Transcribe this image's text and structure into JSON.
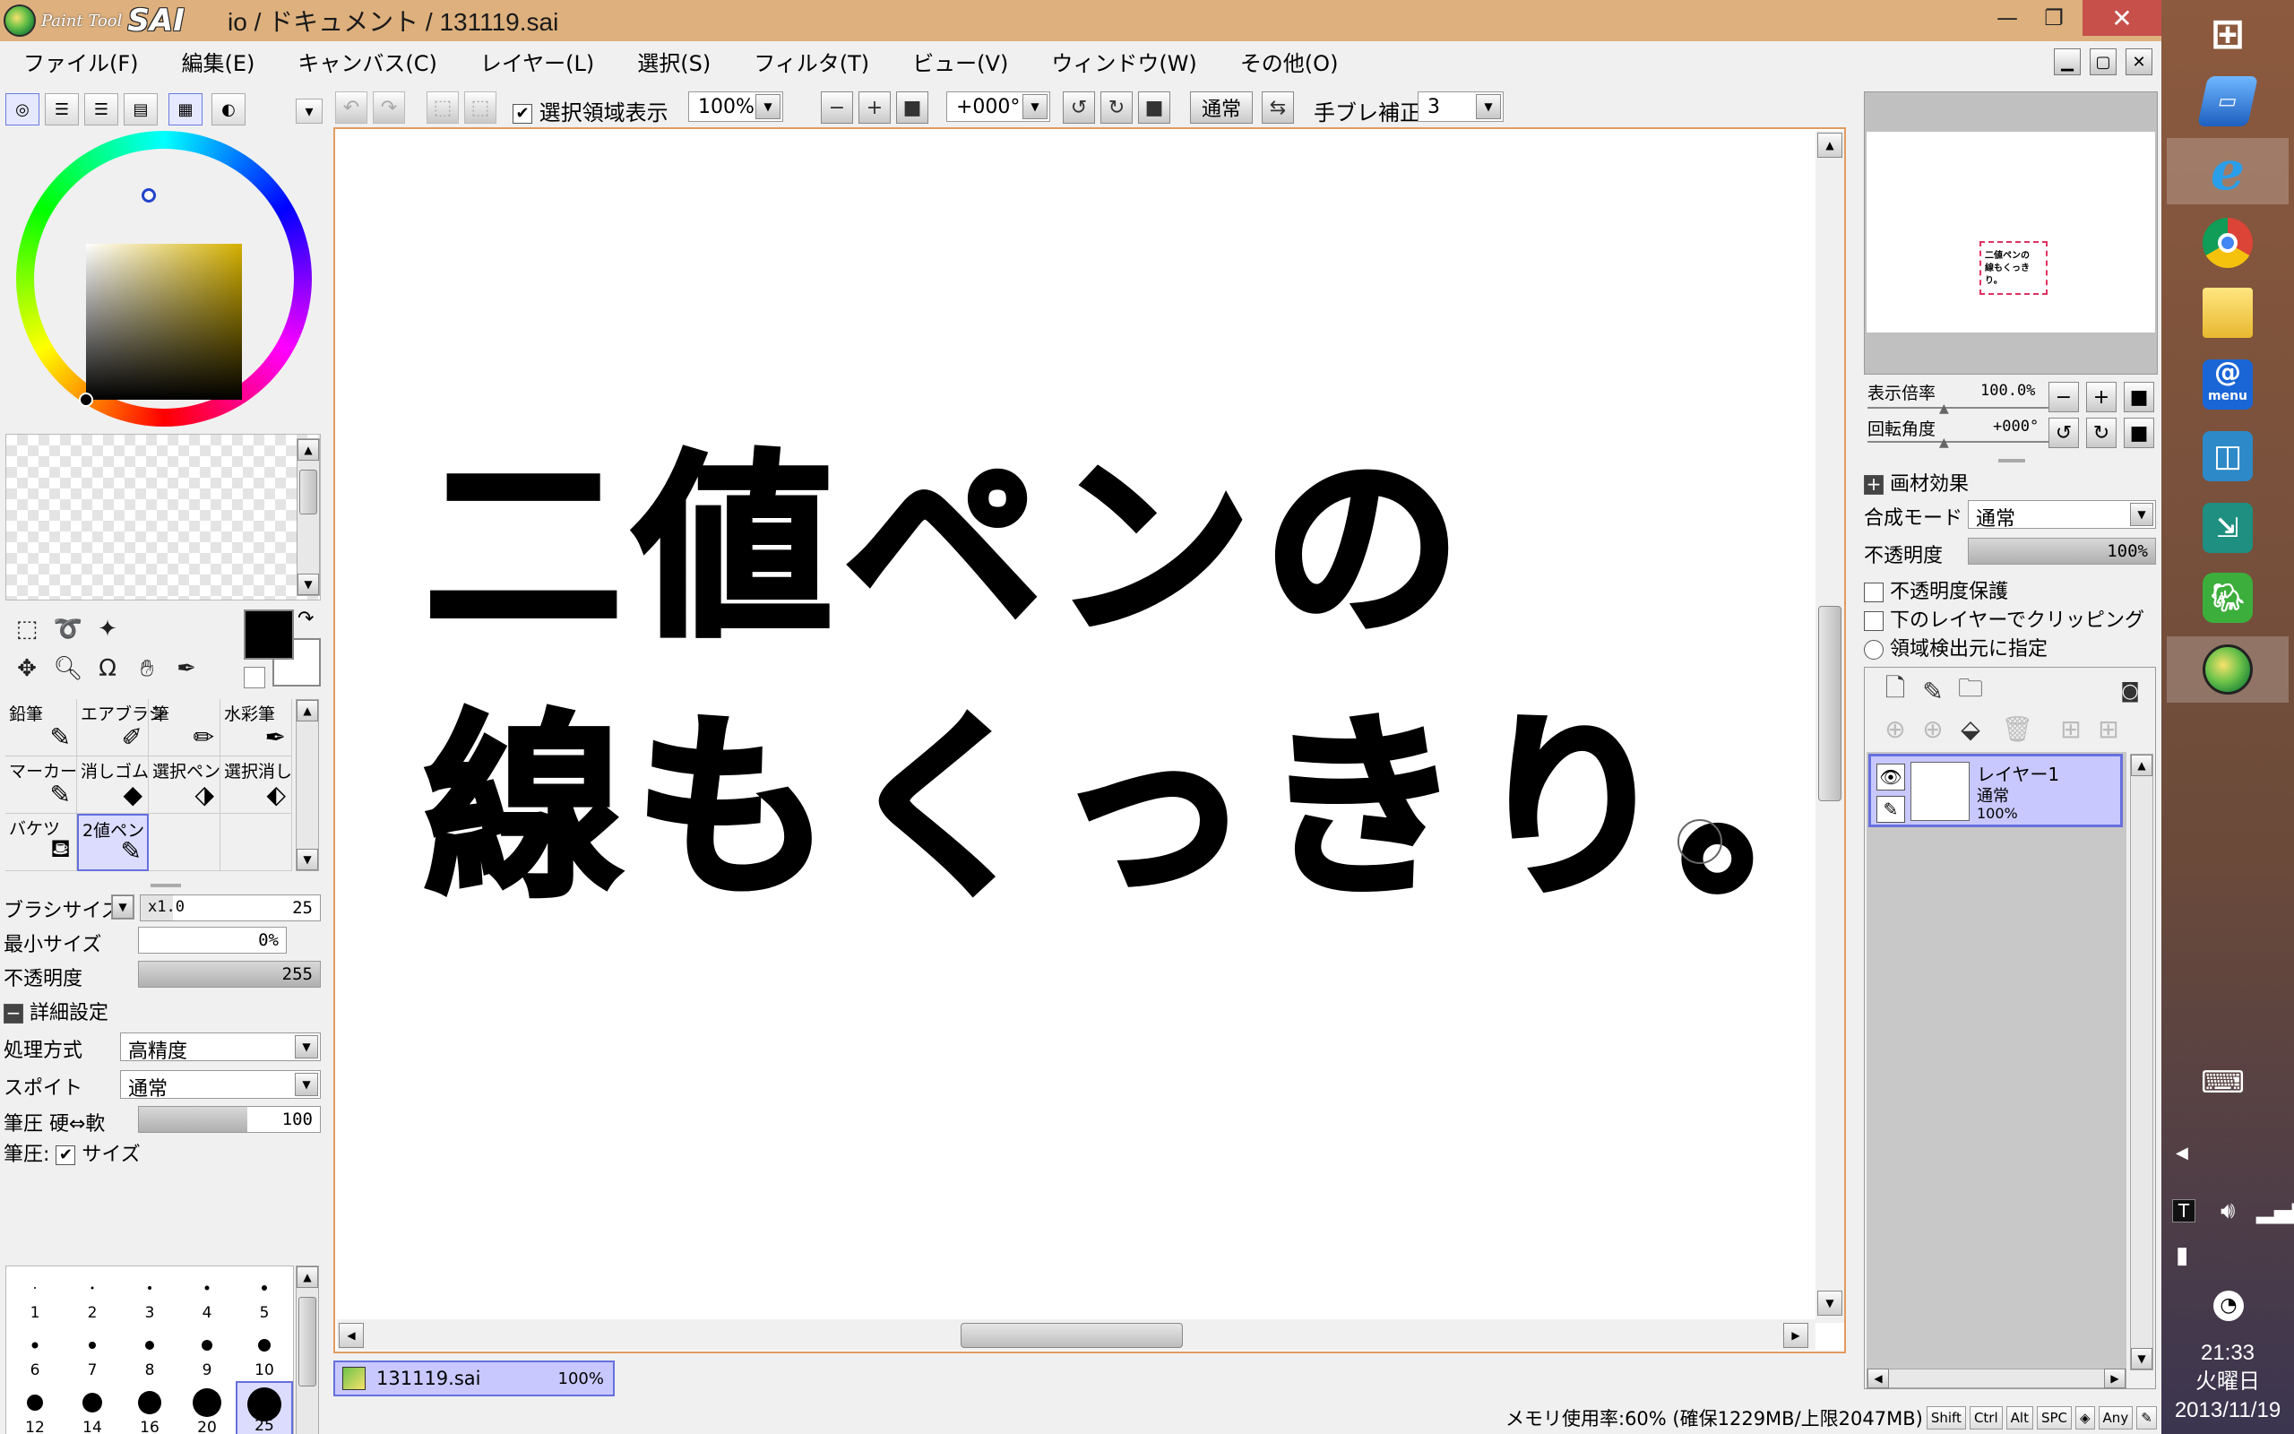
{
  "window": {
    "logo_small": "Paint Tool",
    "logo_big": "SAI",
    "title": "io / ドキュメント / 131119.sai",
    "min_glyph": "—",
    "max_glyph": "❐",
    "close_glyph": "✕"
  },
  "menu": {
    "items": [
      "ファイル(F)",
      "編集(E)",
      "キャンバス(C)",
      "レイヤー(L)",
      "選択(S)",
      "フィルタ(T)",
      "ビュー(V)",
      "ウィンドウ(W)",
      "その他(O)"
    ]
  },
  "toolbar": {
    "show_selection_label": "選択領域表示",
    "show_selection_checked": true,
    "zoom": "100%",
    "rotation": "+000°",
    "blend": "通常",
    "stabilizer_label": "手ブレ補正",
    "stabilizer_value": "3"
  },
  "tools": {
    "brushes": [
      {
        "label": "鉛筆",
        "icon": "pencil-icon"
      },
      {
        "label": "エアブラシ",
        "icon": "airbrush-icon"
      },
      {
        "label": "筆",
        "icon": "brush-icon"
      },
      {
        "label": "水彩筆",
        "icon": "watercolor-icon"
      },
      {
        "label": "マーカー",
        "icon": "marker-icon"
      },
      {
        "label": "消しゴム",
        "icon": "eraser-icon"
      },
      {
        "label": "選択ペン",
        "icon": "select-pen-icon"
      },
      {
        "label": "選択消し",
        "icon": "select-eraser-icon"
      },
      {
        "label": "バケツ",
        "icon": "bucket-icon"
      },
      {
        "label": "2値ペン",
        "icon": "binary-pen-icon",
        "active": true
      }
    ]
  },
  "brush_params": {
    "size_label": "ブラシサイズ",
    "size_multiplier": "x1.0",
    "size_value": "25",
    "min_size_label": "最小サイズ",
    "min_size_value": "0%",
    "opacity_label": "不透明度",
    "opacity_value": "255",
    "details_label": "詳細設定",
    "quality_label": "処理方式",
    "quality_value": "高精度",
    "spuit_label": "スポイト",
    "spuit_value": "通常",
    "pressure_hardness_label": "筆圧 硬⇔軟",
    "pressure_hardness_value": "100",
    "pressure_hardness_fraction": 0.6,
    "pressure_label": "筆圧:",
    "pressure_size_label": "サイズ",
    "pressure_size_checked": true
  },
  "brush_sizes": {
    "labels": [
      "1",
      "2",
      "3",
      "4",
      "5",
      "6",
      "7",
      "8",
      "9",
      "10",
      "12",
      "14",
      "16",
      "20",
      "25"
    ],
    "selected": "25"
  },
  "canvas": {
    "line1": "二値ペンの",
    "line2": "線もくっきり。"
  },
  "document_tab": {
    "name": "131119.sai",
    "zoom": "100%"
  },
  "navigator": {
    "thumb_line1": "二値ペンの",
    "thumb_line2": "線もくっきり。",
    "zoom_label": "表示倍率",
    "zoom_value": "100.0%",
    "angle_label": "回転角度",
    "angle_value": "+000°"
  },
  "layer_props": {
    "texture_label": "画材効果",
    "blend_label": "合成モード",
    "blend_value": "通常",
    "opacity_label": "不透明度",
    "opacity_value": "100%",
    "protect_label": "不透明度保護",
    "clip_label": "下のレイヤーでクリッピング",
    "source_label": "領域検出元に指定"
  },
  "layers": [
    {
      "name": "レイヤー1",
      "mode": "通常",
      "opacity": "100%"
    }
  ],
  "status": {
    "memory": "メモリ使用率:60% (確保1229MB/上限2047MB)",
    "keys": [
      "Shift",
      "Ctrl",
      "Alt",
      "SPC",
      "◈",
      "Any",
      "✎"
    ]
  },
  "taskbar": {
    "time": "21:33",
    "weekday": "火曜日",
    "date": "2013/11/19",
    "menu_label": "menu",
    "apps": [
      "windows-start-icon",
      "remote-desktop-icon",
      "internet-explorer-icon",
      "chrome-icon",
      "file-explorer-icon",
      "at-menu-icon",
      "store-icon",
      "connect-icon",
      "evernote-icon",
      "paint-tool-sai-icon"
    ]
  },
  "colors": {
    "titlebar": "#ddb07d",
    "selection": "#c8c8ff",
    "selection_border": "#6670dd",
    "canvas_border": "#e39b5e",
    "close_button": "#c7504b"
  }
}
